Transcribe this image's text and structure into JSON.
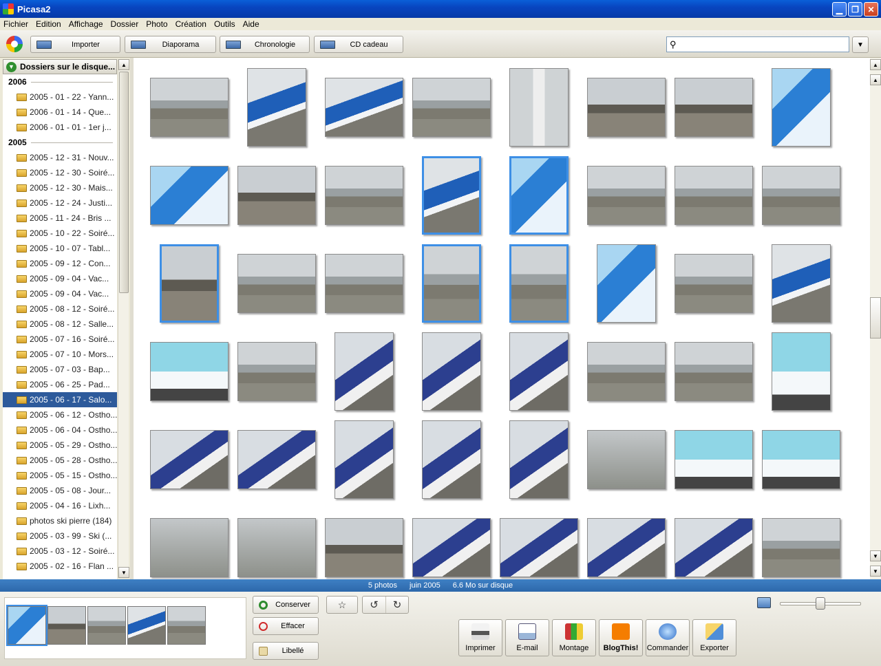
{
  "window": {
    "title": "Picasa2"
  },
  "menu": [
    "Fichier",
    "Edition",
    "Affichage",
    "Dossier",
    "Photo",
    "Création",
    "Outils",
    "Aide"
  ],
  "toolbar": {
    "import_label": "Importer",
    "slideshow_label": "Diaporama",
    "timeline_label": "Chronologie",
    "cdgift_label": "CD cadeau",
    "search_value": ""
  },
  "folders": {
    "header": "Dossiers sur le disque...",
    "groups": [
      {
        "year": "2006",
        "items": [
          "2005 - 01 - 22 - Yann...",
          "2006 - 01 - 14 - Que...",
          "2006 - 01 - 01 - 1er j..."
        ]
      },
      {
        "year": "2005",
        "items": [
          "2005 - 12 - 31 - Nouv...",
          "2005 - 12 - 30 - Soiré...",
          "2005 - 12 - 30 - Mais...",
          "2005 - 12 - 24 - Justi...",
          "2005 - 11 - 24 - Bris ...",
          "2005 - 10 - 22 - Soiré...",
          "2005 - 10 - 07 - Tabl...",
          "2005 - 09 - 12 - Con...",
          "2005 - 09 - 04 - Vac...",
          "2005 - 09 - 04 - Vac...",
          "2005 - 08 - 12 - Soiré...",
          "2005 - 08 - 12 - Salle...",
          "2005 - 07 - 16 - Soiré...",
          "2005 - 07 - 10 - Mors...",
          "2005 - 07 - 03 - Bap...",
          "2005 - 06 - 25 - Pad...",
          "2005 - 06 - 17 - Salo...",
          "2005 - 06 - 12 - Ostho...",
          "2005 - 06 - 04 - Ostho...",
          "2005 - 05 - 29 - Ostho...",
          "2005 - 05 - 28 - Ostho...",
          "2005 - 05 - 15 - Ostho...",
          "2005 - 05 - 08 - Jour...",
          "2005 - 04 - 16 - Lixh...",
          "photos ski pierre (184)",
          "2005 - 03 - 99 - Ski (...",
          "2005 - 03 - 12 - Soiré...",
          "2005 - 02 - 16 - Flan ..."
        ]
      }
    ],
    "selected": "2005 - 06 - 17 - Salo..."
  },
  "status": {
    "count": "5 photos",
    "date": "juin 2005",
    "size": "6.6 Mo sur disque"
  },
  "tray": {
    "keep_label": "Conserver",
    "clear_label": "Effacer",
    "caption_label": "Libellé"
  },
  "actions": [
    "Imprimer",
    "E-mail",
    "Montage",
    "BlogThis!",
    "Commander",
    "Exporter"
  ],
  "zoom_level": 0.5,
  "colors": {
    "selection": "#2d5a9b",
    "statusbar": "#3f80c4",
    "title_bar": "#0845c0"
  }
}
